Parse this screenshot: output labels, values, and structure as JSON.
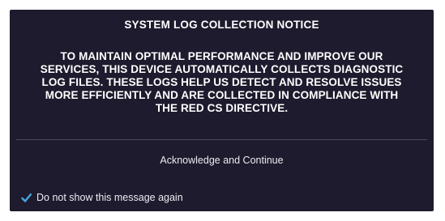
{
  "dialog": {
    "title": "SYSTEM LOG COLLECTION NOTICE",
    "message_lines": [
      "TO MAINTAIN OPTIMAL PERFORMANCE AND IMPROVE OUR",
      "SERVICES, THIS DEVICE AUTOMATICALLY COLLECTS DIAGNOSTIC",
      "LOG FILES. THESE LOGS HELP US DETECT AND RESOLVE ISSUES",
      "MORE EFFICIENTLY AND ARE COLLECTED IN COMPLIANCE WITH",
      "THE RED CS DIRECTIVE."
    ],
    "primary_button_label": "Acknowledge and Continue",
    "checkbox": {
      "label": "Do not show this message again",
      "checked": true,
      "icon": "checkmark-icon"
    }
  },
  "colors": {
    "dialog_background": "#1d1b2d",
    "text": "#ffffff",
    "divider": "#4c4a5e",
    "checkmark": "#4aa3df"
  }
}
